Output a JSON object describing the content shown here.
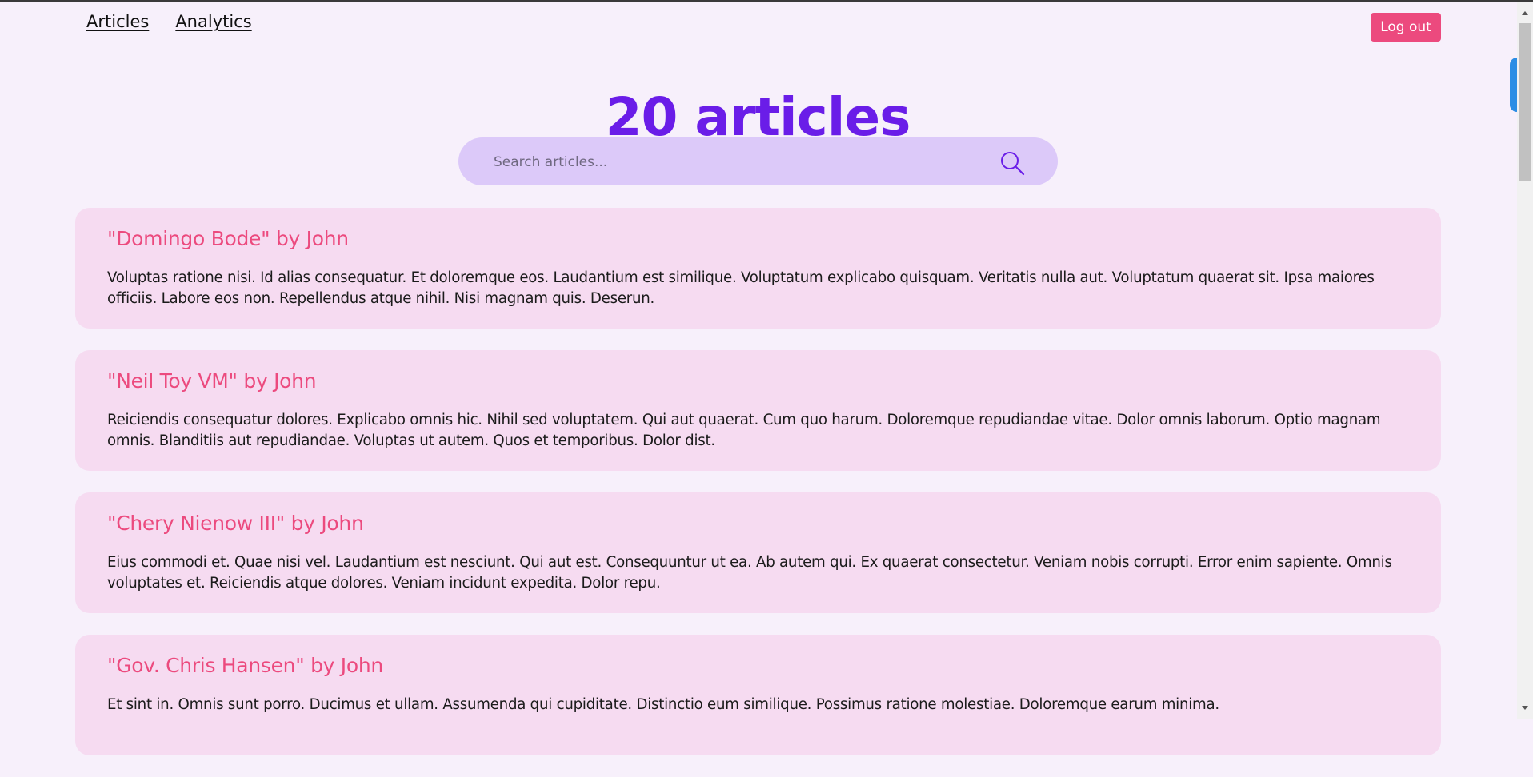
{
  "nav": {
    "articles_label": "Articles",
    "analytics_label": "Analytics"
  },
  "header": {
    "logout_label": "Log out",
    "title": "20 articles"
  },
  "search": {
    "placeholder": "Search articles...",
    "value": "",
    "icon": "search-icon"
  },
  "colors": {
    "accent": "#6a1de8",
    "brand_pink": "#ec4a7e",
    "card_bg": "#f6dbf1",
    "search_bg": "#dcc9f9",
    "page_bg": "#f7f0fb"
  },
  "articles": [
    {
      "title": "\"Domingo Bode\" by John",
      "body": "Voluptas ratione nisi. Id alias consequatur. Et doloremque eos. Laudantium est similique. Voluptatum explicabo quisquam. Veritatis nulla aut. Voluptatum quaerat sit. Ipsa maiores officiis. Labore eos non. Repellendus atque nihil. Nisi magnam quis. Deserun."
    },
    {
      "title": "\"Neil Toy VM\" by John",
      "body": "Reiciendis consequatur dolores. Explicabo omnis hic. Nihil sed voluptatem. Qui aut quaerat. Cum quo harum. Doloremque repudiandae vitae. Dolor omnis laborum. Optio magnam omnis. Blanditiis aut repudiandae. Voluptas ut autem. Quos et temporibus. Dolor dist."
    },
    {
      "title": "\"Chery Nienow III\" by John",
      "body": "Eius commodi et. Quae nisi vel. Laudantium est nesciunt. Qui aut est. Consequuntur ut ea. Ab autem qui. Ex quaerat consectetur. Veniam nobis corrupti. Error enim sapiente. Omnis voluptates et. Reiciendis atque dolores. Veniam incidunt expedita. Dolor repu."
    },
    {
      "title": "\"Gov. Chris Hansen\" by John",
      "body": "Et sint in. Omnis sunt porro. Ducimus et ullam. Assumenda qui cupiditate. Distinctio eum similique. Possimus ratione molestiae. Doloremque earum minima."
    }
  ]
}
